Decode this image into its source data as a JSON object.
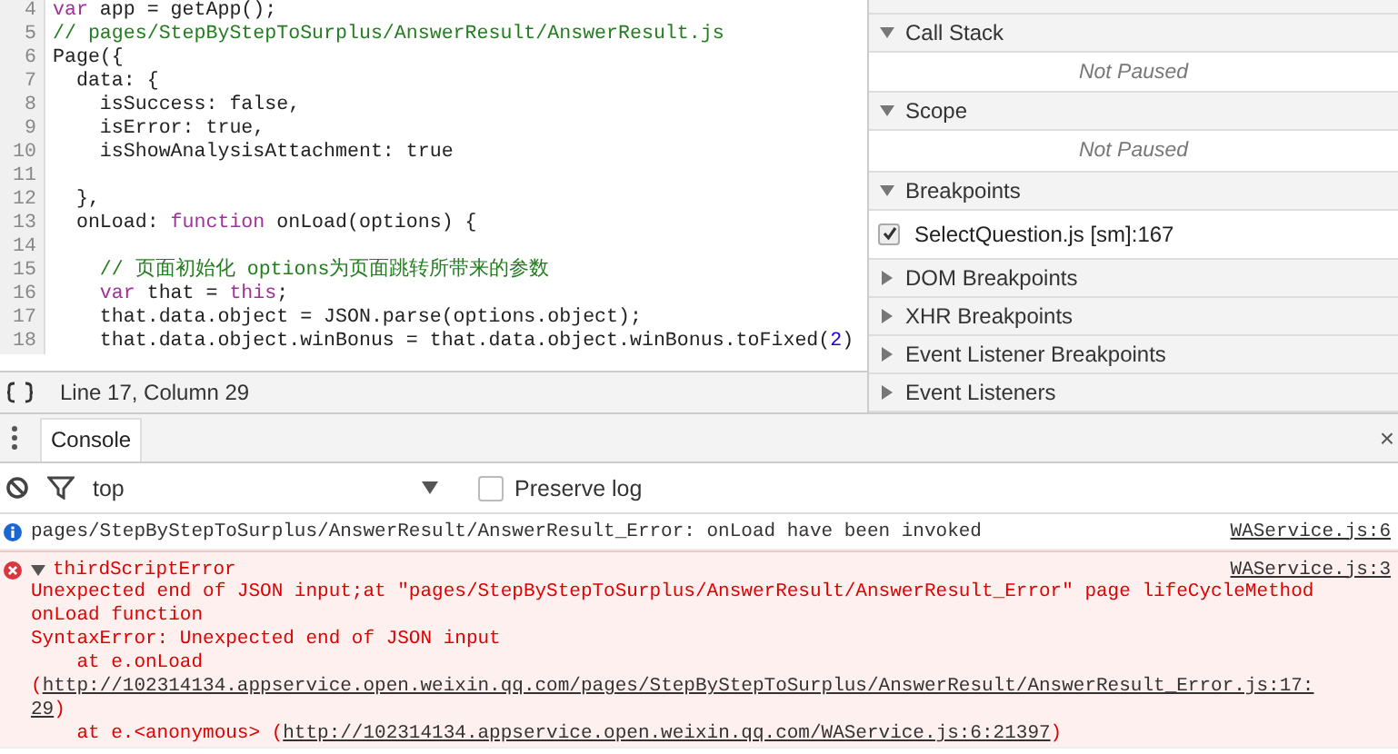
{
  "editor": {
    "lines": [
      {
        "number": "4",
        "tokens": [
          {
            "kind": "keyword",
            "text": "var"
          },
          {
            "kind": "plain",
            "text": " app = getApp();"
          }
        ]
      },
      {
        "number": "5",
        "tokens": [
          {
            "kind": "comment",
            "text": "// pages/StepByStepToSurplus/AnswerResult/AnswerResult.js"
          }
        ]
      },
      {
        "number": "6",
        "tokens": [
          {
            "kind": "plain",
            "text": "Page({"
          }
        ]
      },
      {
        "number": "7",
        "tokens": [
          {
            "kind": "plain",
            "text": "  data: {"
          }
        ]
      },
      {
        "number": "8",
        "tokens": [
          {
            "kind": "plain",
            "text": "    isSuccess: false,"
          }
        ]
      },
      {
        "number": "9",
        "tokens": [
          {
            "kind": "plain",
            "text": "    isError: true,"
          }
        ]
      },
      {
        "number": "10",
        "tokens": [
          {
            "kind": "plain",
            "text": "    isShowAnalysisAttachment: true"
          }
        ]
      },
      {
        "number": "11"
      },
      {
        "number": "12",
        "tokens": [
          {
            "kind": "plain",
            "text": "  },"
          }
        ]
      },
      {
        "number": "13",
        "tokens": [
          {
            "kind": "plain",
            "text": "  onLoad: "
          },
          {
            "kind": "keyword",
            "text": "function"
          },
          {
            "kind": "plain",
            "text": " onLoad(options) {"
          }
        ]
      },
      {
        "number": "14"
      },
      {
        "number": "15",
        "tokens": [
          {
            "kind": "comment",
            "text": "    // 页面初始化 options为页面跳转所带来的参数"
          }
        ]
      },
      {
        "number": "16",
        "tokens": [
          {
            "kind": "keyword",
            "text": "    var"
          },
          {
            "kind": "plain",
            "text": " that = "
          },
          {
            "kind": "keyword",
            "text": "this"
          },
          {
            "kind": "plain",
            "text": ";"
          }
        ]
      },
      {
        "number": "17",
        "tokens": [
          {
            "kind": "plain",
            "text": "    that.data.object = JSON.parse(options.object);"
          }
        ]
      },
      {
        "number": "18",
        "tokens": [
          {
            "kind": "plain",
            "text": "    that.data.object.winBonus = that.data.object.winBonus.toFixed("
          },
          {
            "kind": "number",
            "text": "2"
          },
          {
            "kind": "plain",
            "text": ")"
          }
        ]
      }
    ],
    "status": "Line 17, Column 29"
  },
  "sidebar": {
    "sections": [
      {
        "title": "Call Stack",
        "expanded": true,
        "body": {
          "kind": "note",
          "text": "Not Paused"
        }
      },
      {
        "title": "Scope",
        "expanded": true,
        "body": {
          "kind": "note",
          "text": "Not Paused"
        }
      },
      {
        "title": "Breakpoints",
        "expanded": true,
        "body": {
          "kind": "breakpoint",
          "text": "SelectQuestion.js [sm]:167",
          "checked": true
        }
      },
      {
        "title": "DOM Breakpoints",
        "expanded": false
      },
      {
        "title": "XHR Breakpoints",
        "expanded": false
      },
      {
        "title": "Event Listener Breakpoints",
        "expanded": false
      },
      {
        "title": "Event Listeners",
        "expanded": false
      }
    ]
  },
  "drawer": {
    "tabs": [
      {
        "label": "Console",
        "selected": true
      }
    ],
    "close": "×"
  },
  "console": {
    "context": "top",
    "preserve_log": {
      "label": "Preserve log",
      "checked": false
    },
    "messages": [
      {
        "kind": "info",
        "text": "pages/StepByStepToSurplus/AnswerResult/AnswerResult_Error: onLoad have been invoked",
        "source": "WAService.js:6"
      },
      {
        "kind": "error",
        "title": "thirdScriptError",
        "expanded": true,
        "source": "WAService.js:3",
        "lines": [
          {
            "parts": [
              {
                "kind": "text",
                "text": "Unexpected end of JSON input;at \"pages/StepByStepToSurplus/AnswerResult/AnswerResult_Error\" page lifeCycleMethod"
              }
            ]
          },
          {
            "parts": [
              {
                "kind": "text",
                "text": "onLoad function"
              }
            ]
          },
          {
            "parts": [
              {
                "kind": "text",
                "text": "SyntaxError: Unexpected end of JSON input"
              }
            ]
          },
          {
            "parts": [
              {
                "kind": "text",
                "text": "    at e.onLoad"
              }
            ]
          },
          {
            "parts": [
              {
                "kind": "text",
                "text": "("
              },
              {
                "kind": "link",
                "text": "http://102314134.appservice.open.weixin.qq.com/pages/StepByStepToSurplus/AnswerResult/AnswerResult_Error.js:17:"
              }
            ]
          },
          {
            "parts": [
              {
                "kind": "link",
                "text": "29"
              },
              {
                "kind": "text",
                "text": ")"
              }
            ]
          },
          {
            "parts": [
              {
                "kind": "text",
                "text": "    at e.<anonymous> ("
              },
              {
                "kind": "link",
                "text": "http://102314134.appservice.open.weixin.qq.com/WAService.js:6:21397"
              },
              {
                "kind": "text",
                "text": ")"
              }
            ]
          }
        ]
      }
    ]
  }
}
